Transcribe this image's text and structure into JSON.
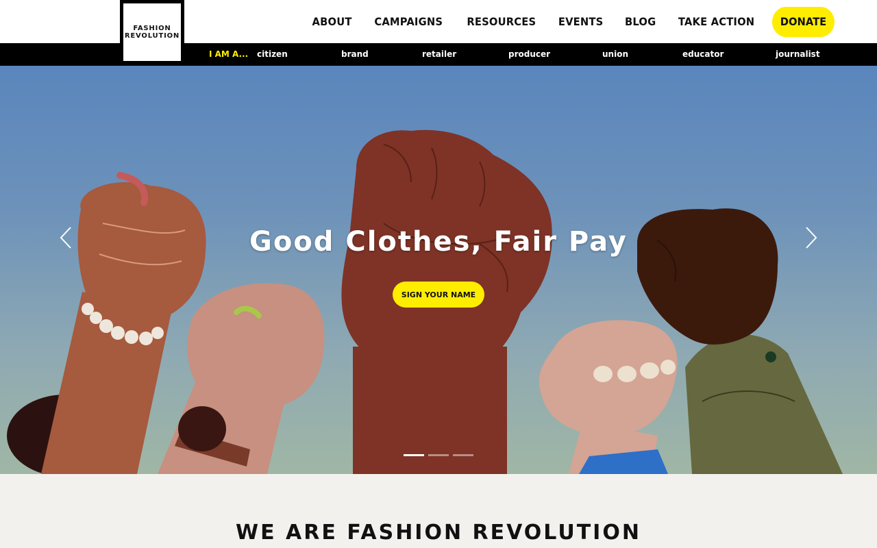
{
  "logo": {
    "line1": "FASHION",
    "line2": "REVOLUTION"
  },
  "nav": {
    "items": [
      "ABOUT",
      "CAMPAIGNS",
      "RESOURCES",
      "EVENTS",
      "BLOG",
      "TAKE ACTION"
    ],
    "donate": "DONATE"
  },
  "subnav": {
    "label": "I AM A...",
    "items": [
      "citizen",
      "brand",
      "retailer",
      "producer",
      "union",
      "educator",
      "journalist"
    ]
  },
  "hero": {
    "title": "Good Clothes, Fair Pay",
    "cta": "SIGN YOUR NAME",
    "slides_total": 3,
    "active_slide": 1
  },
  "section": {
    "title": "WE ARE FASHION REVOLUTION"
  },
  "colors": {
    "accent": "#ffed00",
    "bar": "#000000",
    "section_bg": "#f3f1ee"
  }
}
